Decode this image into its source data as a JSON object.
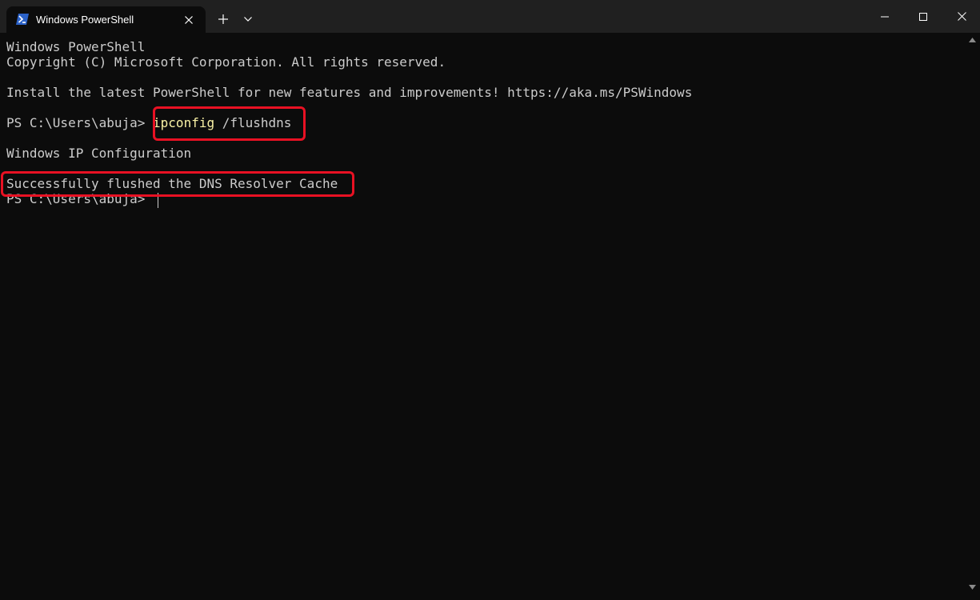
{
  "window": {
    "tab_title": "Windows PowerShell",
    "tab_icon": "powershell-icon",
    "accent": "#e81123"
  },
  "terminal": {
    "line1": "Windows PowerShell",
    "line2": "Copyright (C) Microsoft Corporation. All rights reserved.",
    "line3": "Install the latest PowerShell for new features and improvements! https://aka.ms/PSWindows",
    "prompt1": "PS C:\\Users\\abuja> ",
    "command_name": "ipconfig",
    "command_args": " /flushdns",
    "output1": "Windows IP Configuration",
    "output2": "Successfully flushed the DNS Resolver Cache",
    "prompt2": "PS C:\\Users\\abuja> "
  }
}
